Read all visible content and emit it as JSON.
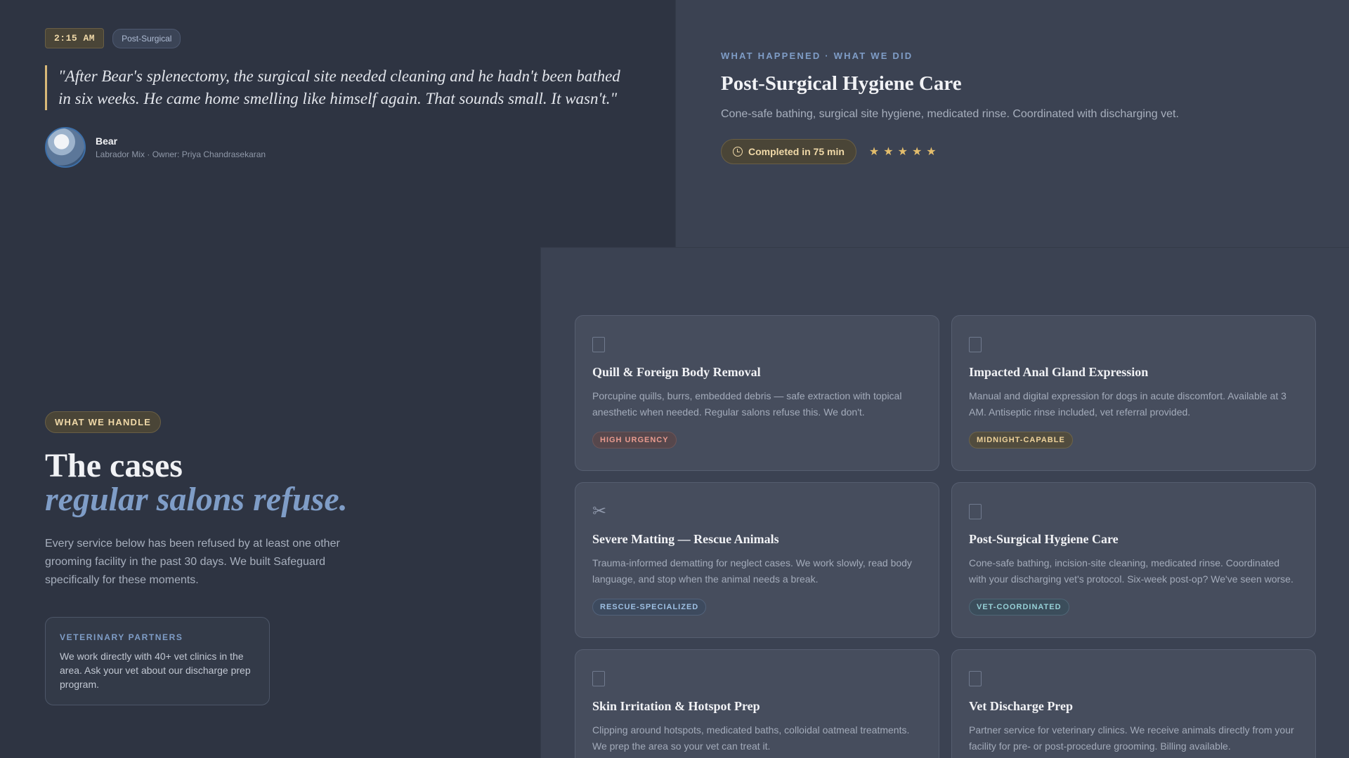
{
  "testimonial": {
    "time": "2:15 AM",
    "category": "Post-Surgical",
    "quote": "\"After Bear's splenectomy, the surgical site needed cleaning and he hadn't been bathed in six weeks. He came home smelling like himself again. That sounds small. It wasn't.\"",
    "pet_name": "Bear",
    "pet_meta": "Labrador Mix · Owner: Priya Chandrasekaran"
  },
  "case_study": {
    "eyebrow": "WHAT HAPPENED · WHAT WE DID",
    "title": "Post-Surgical Hygiene Care",
    "description": "Cone-safe bathing, surgical site hygiene, medicated rinse. Coordinated with discharging vet.",
    "completed_label": "Completed in 75 min",
    "rating": 5,
    "star_glyph": "★"
  },
  "handle": {
    "chip": "WHAT WE HANDLE",
    "heading_line1": "The cases",
    "heading_line2": "regular salons refuse.",
    "intro": "Every service below has been refused by at least one other grooming facility in the past 30 days. We built Safeguard specifically for these moments.",
    "partners_title": "VETERINARY PARTNERS",
    "partners_text": "We work directly with 40+ vet clinics in the area. Ask your vet about our discharge prep program."
  },
  "services": [
    {
      "icon": "document-icon",
      "title": "Quill & Foreign Body Removal",
      "description": "Porcupine quills, burrs, embedded debris — safe extraction with topical anesthetic when needed. Regular salons refuse this. We don't.",
      "badge": "HIGH URGENCY",
      "badge_color": "#e99b8f"
    },
    {
      "icon": "document-icon",
      "title": "Impacted Anal Gland Expression",
      "description": "Manual and digital expression for dogs in acute discomfort. Available at 3 AM. Antiseptic rinse included, vet referral provided.",
      "badge": "MIDNIGHT-CAPABLE",
      "badge_color": "#eed29a"
    },
    {
      "icon": "scissors-icon",
      "title": "Severe Matting — Rescue Animals",
      "description": "Trauma-informed dematting for neglect cases. We work slowly, read body language, and stop when the animal needs a break.",
      "badge": "RESCUE-SPECIALIZED",
      "badge_color": "#9ec0e3"
    },
    {
      "icon": "document-icon",
      "title": "Post-Surgical Hygiene Care",
      "description": "Cone-safe bathing, incision-site cleaning, medicated rinse. Coordinated with your discharging vet's protocol. Six-week post-op? We've seen worse.",
      "badge": "VET-COORDINATED",
      "badge_color": "#96d0d6"
    },
    {
      "icon": "document-icon",
      "title": "Skin Irritation & Hotspot Prep",
      "description": "Clipping around hotspots, medicated baths, colloidal oatmeal treatments. We prep the area so your vet can treat it."
    },
    {
      "icon": "document-icon",
      "title": "Vet Discharge Prep",
      "description": "Partner service for veterinary clinics. We receive animals directly from your facility for pre- or post-procedure grooming. Billing available."
    }
  ],
  "scissors_glyph": "✂"
}
